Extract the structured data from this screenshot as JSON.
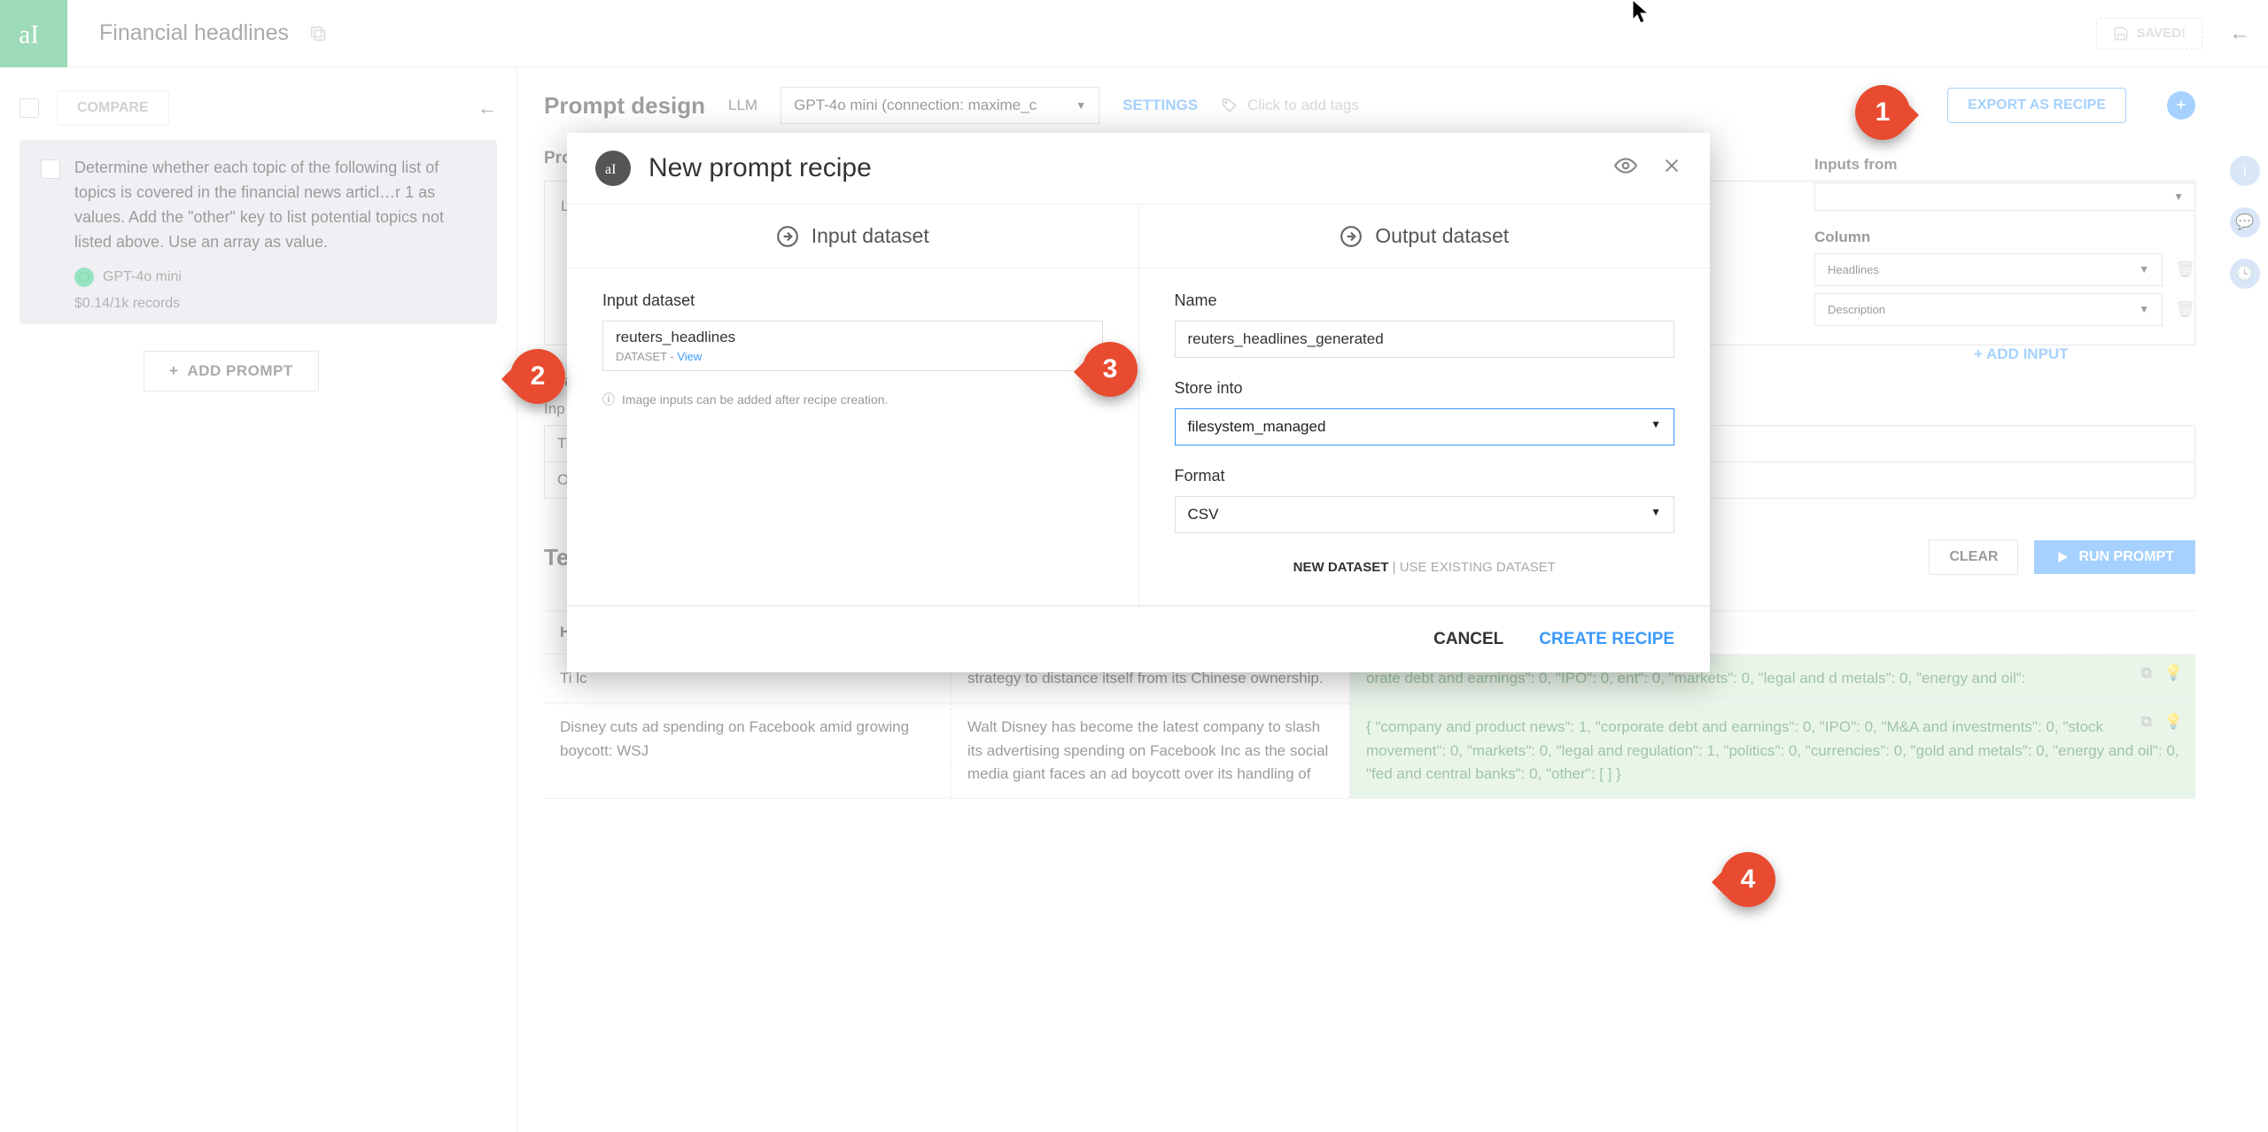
{
  "topbar": {
    "page_title": "Financial headlines",
    "saved_label": "SAVED!"
  },
  "left": {
    "compare_label": "COMPARE",
    "prompt_text": "Determine whether each topic of the following list of topics is covered in the financial news articl…r 1 as values. Add the \"other\" key to list potential topics not listed above. Use an array as value.",
    "model_label": "GPT-4o mini",
    "cost_label": "$0.14/1k records",
    "add_prompt_label": "ADD PROMPT"
  },
  "design": {
    "title": "Prompt design",
    "llm_label": "LLM",
    "llm_value": "GPT-4o mini (connection: maxime_c",
    "settings": "SETTINGS",
    "tags_placeholder": "Click to add tags",
    "export_label": "EXPORT AS RECIPE"
  },
  "prompt_section": {
    "label": "Pro",
    "body": "Li\nea\nar"
  },
  "inputs_panel": {
    "inputs_label": "Inputs from",
    "column_label": "Column",
    "col1": "Headlines",
    "col2": "Description",
    "add_label": "+ ADD INPUT"
  },
  "examples": {
    "label": "Exa",
    "in_label": "Inp",
    "row1": "Ti",
    "row2": "O"
  },
  "test": {
    "title": "Tes",
    "clear": "CLEAR",
    "run": "RUN PROMPT",
    "h1": "H",
    "rows": [
      {
        "headline": "Ti\nlc",
        "desc": "strategy to distance itself from its Chinese ownership.",
        "out": "orate debt and earnings\": 0, \"IPO\": 0, ent\": 0, \"markets\": 0, \"legal and d metals\": 0, \"energy and oil\":"
      },
      {
        "headline": "Disney cuts ad spending on Facebook amid growing boycott: WSJ",
        "desc": "Walt Disney has become the latest company to slash its advertising spending on Facebook Inc as the social media giant faces an ad boycott over its handling of",
        "out": "{ \"company and product news\": 1, \"corporate debt and earnings\": 0, \"IPO\": 0, \"M&A and investments\": 0, \"stock movement\": 0, \"markets\": 0, \"legal and regulation\": 1, \"politics\": 0, \"currencies\": 0, \"gold and metals\": 0, \"energy and oil\": 0, \"fed and central banks\": 0, \"other\": [ ] }"
      }
    ]
  },
  "modal": {
    "title": "New prompt recipe",
    "input_tab": "Input dataset",
    "output_tab": "Output dataset",
    "input_label": "Input dataset",
    "input_value": "reuters_headlines",
    "input_type": "DATASET",
    "input_view": "View",
    "input_info": "Image inputs can be added after recipe creation.",
    "name_label": "Name",
    "name_value": "reuters_headlines_generated",
    "store_label": "Store into",
    "store_value": "filesystem_managed",
    "format_label": "Format",
    "format_value": "CSV",
    "new_dataset": "NEW DATASET",
    "use_existing": "USE EXISTING DATASET",
    "cancel": "CANCEL",
    "create": "CREATE RECIPE"
  },
  "callouts": {
    "c1": "1",
    "c2": "2",
    "c3": "3",
    "c4": "4"
  }
}
